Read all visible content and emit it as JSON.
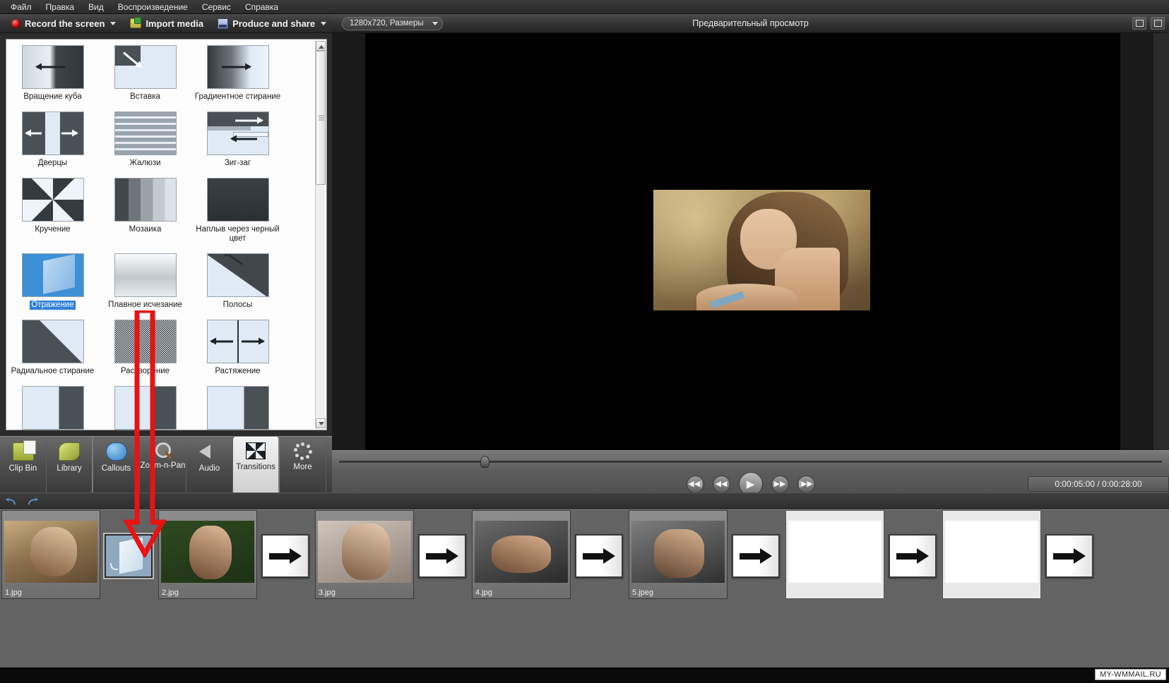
{
  "menu": {
    "items": [
      {
        "label": "Файл"
      },
      {
        "label": "Правка"
      },
      {
        "label": "Вид"
      },
      {
        "label": "Воспроизведение"
      },
      {
        "label": "Сервис"
      },
      {
        "label": "Справка"
      }
    ]
  },
  "toolbar": {
    "record_label": "Record the screen",
    "import_label": "Import media",
    "produce_label": "Produce and share"
  },
  "transitions_panel": {
    "items": [
      {
        "label": "Вращение куба",
        "art": "t-cube",
        "selected": false
      },
      {
        "label": "Вставка",
        "art": "t-insert",
        "selected": false
      },
      {
        "label": "Градиентное стирание",
        "art": "t-grad",
        "selected": false
      },
      {
        "label": "Дверцы",
        "art": "t-doors",
        "selected": false
      },
      {
        "label": "Жалюзи",
        "art": "t-blinds",
        "selected": false
      },
      {
        "label": "Зиг-заг",
        "art": "t-zigzag",
        "selected": false
      },
      {
        "label": "Кручение",
        "art": "t-twist",
        "selected": false
      },
      {
        "label": "Мозаика",
        "art": "t-mosaic",
        "selected": false
      },
      {
        "label": "Наплыв через черный цвет",
        "art": "t-fadeblack",
        "selected": false
      },
      {
        "label": "Отражение",
        "art": "t-reflect",
        "selected": true
      },
      {
        "label": "Плавное исчезание",
        "art": "t-fade",
        "selected": false
      },
      {
        "label": "Полосы",
        "art": "t-stripes",
        "selected": false
      },
      {
        "label": "Радиальное стирание",
        "art": "t-radial",
        "selected": false
      },
      {
        "label": "Растворение",
        "art": "t-dissolve",
        "selected": false
      },
      {
        "label": "Растяжение",
        "art": "t-stretch",
        "selected": false
      }
    ]
  },
  "tabs": {
    "items": [
      {
        "label": "Clip Bin",
        "icon": "clip-bin-icon",
        "active": false
      },
      {
        "label": "Library",
        "icon": "library-icon",
        "active": false
      },
      {
        "label": "Callouts",
        "icon": "callouts-icon",
        "active": false
      },
      {
        "label": "Zoom-n-Pan",
        "icon": "zoom-n-pan-icon",
        "active": false
      },
      {
        "label": "Audio",
        "icon": "audio-icon",
        "active": false
      },
      {
        "label": "Transitions",
        "icon": "transitions-icon",
        "active": true
      },
      {
        "label": "More",
        "icon": "more-icon",
        "active": false
      }
    ]
  },
  "preview": {
    "dimensions_label": "1280x720, Размеры",
    "title": "Предварительный просмотр",
    "timecode": "0:00:05:00 / 0:00:28:00",
    "transport": {
      "prev_label": "◀◀|",
      "rewind_label": "◀◀",
      "play_label": "▶",
      "forward_label": "▶▶",
      "next_label": "|▶▶"
    }
  },
  "timeline": {
    "undo_label": "undo-icon",
    "redo_label": "redo-icon",
    "clips": [
      {
        "kind": "image",
        "name": "1.jpg",
        "art": "ph1"
      },
      {
        "kind": "transition",
        "name": "Отражение",
        "art": "reflect",
        "selected": true
      },
      {
        "kind": "image",
        "name": "2.jpg",
        "art": "ph2"
      },
      {
        "kind": "transition",
        "name": "Переход",
        "art": "arrow",
        "selected": false
      },
      {
        "kind": "image",
        "name": "3.jpg",
        "art": "ph3"
      },
      {
        "kind": "transition",
        "name": "Переход",
        "art": "arrow",
        "selected": false
      },
      {
        "kind": "image",
        "name": "4.jpg",
        "art": "ph4"
      },
      {
        "kind": "transition",
        "name": "Переход",
        "art": "arrow",
        "selected": false
      },
      {
        "kind": "image",
        "name": "5.jpeg",
        "art": "ph5"
      },
      {
        "kind": "transition",
        "name": "Переход",
        "art": "arrow",
        "selected": false
      },
      {
        "kind": "blank",
        "name": "",
        "art": ""
      },
      {
        "kind": "transition",
        "name": "Переход",
        "art": "arrow",
        "selected": false
      },
      {
        "kind": "blank",
        "name": "",
        "art": ""
      },
      {
        "kind": "transition",
        "name": "Переход",
        "art": "arrow",
        "selected": false
      }
    ]
  },
  "watermark": {
    "text": "MY-WMMAIL.RU"
  },
  "colors": {
    "accent": "#2f7fd8",
    "annotation_red": "#e81313",
    "panel_bg": "#2b2b2b",
    "storyboard_bg": "#636363"
  }
}
